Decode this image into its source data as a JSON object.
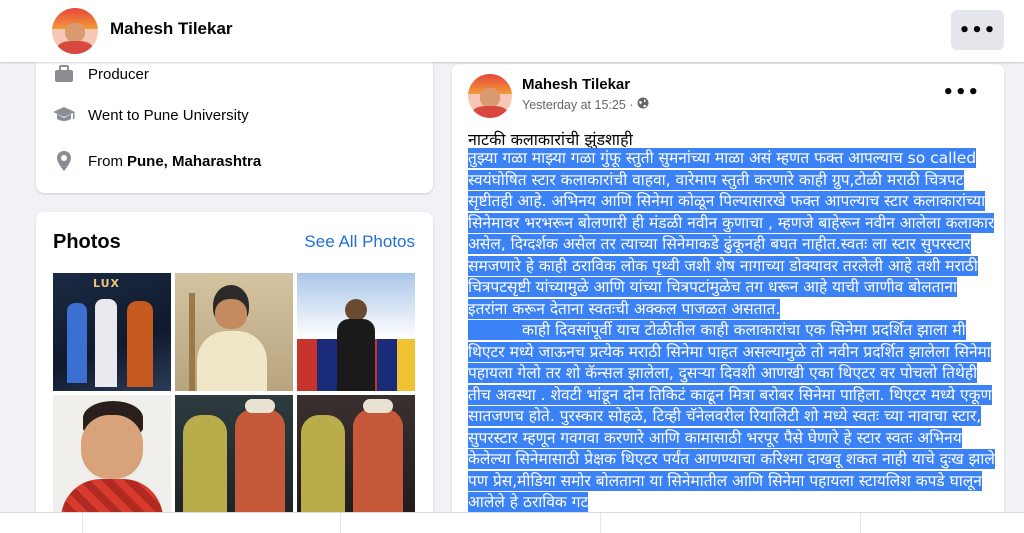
{
  "header": {
    "name": "Mahesh Tilekar",
    "more_label": "•••"
  },
  "intro": {
    "items": [
      {
        "icon": "briefcase-icon",
        "text": "Producer",
        "bold": ""
      },
      {
        "icon": "graduation-cap-icon",
        "text": "Went to Pune University",
        "bold": ""
      },
      {
        "icon": "location-pin-icon",
        "text": "From",
        "bold": "Pune, Maharashtra"
      }
    ]
  },
  "photos": {
    "title": "Photos",
    "see_all": "See All Photos",
    "tiles": [
      {
        "label": "LUX"
      },
      {
        "label": ""
      },
      {
        "label": ""
      },
      {
        "label": ""
      },
      {
        "label": ""
      },
      {
        "label": ""
      }
    ]
  },
  "post": {
    "author": "Mahesh Tilekar",
    "timestamp": "Yesterday at 15:25 ·",
    "privacy_icon": "globe-icon",
    "more_label": "•••",
    "title": "नाटकी कलाकारांची झुंडशाही",
    "paragraph1": "तुझ्या गळा माझ्या गळा गुंफू स्तुती सुमनांच्या माळा असं म्हणत फक्त आपल्याच so called स्वयंघोषित स्टार कलाकारांची वाहवा, वारेमाप स्तुती करणारे काही ग्रुप,टोळी मराठी चित्रपट सृष्टीतही आहे. अभिनय आणि सिनेमा कोळून पिल्यासारखे फक्त आपल्याच स्टार कलाकारांच्या सिनेमावर भरभरून बोलणारी ही मंडळी नवीन कुणाचा , म्हणजे बाहेरून नवीन आलेला कलाकार असेल, दिग्दर्शक असेल तर त्याच्या सिनेमाकडे ढुंकूनही बघत नाहीत.स्वतः ला स्टार सुपरस्टार समजणारे हे काही ठराविक लोक पृथ्वी जशी शेष नागाच्या डोक्यावर तरलेली आहे तशी मराठी चित्रपटसृष्टी यांच्यामुळे आणि यांच्या चित्रपटांमुळेच तग धरून आहे याची जाणीव  बोलताना इतरांना करून देताना स्वतःची अक्कल पाजळत असतात.",
    "paragraph2": "काही दिवसांपूर्वी याच टोळीतील काही कलाकारांचा एक  सिनेमा प्रदर्शित झाला मी थिएटर मध्ये  जाऊनच प्रत्येक मराठी सिनेमा पाहत असल्यामुळे तो नवीन प्रदर्शित झालेला सिनेमा पहायला गेलो तर शो कॅन्सल झालेला, दुसऱ्या दिवशी आणखी एका थिएटर वर पोचलो तिथेही तीच अवस्था . शेवटी भांडून दोन तिकिटं काढून मित्रा बरोबर सिनेमा पाहिला. थिएटर मध्ये एकूण सातजणच होते. पुरस्कार सोहळे, टिव्ही चॅनेलवरील रियालिटी शो मध्ये स्वतः च्या नावाचा स्टार, सुपरस्टार म्हणून गवगवा करणारे आणि कामासाठी भरपूर पैसे घेणारे हे स्टार स्वतः अभिनय केलेल्या सिनेमासाठी प्रेक्षक थिएटर पर्यंत आणण्याचा करिश्मा दाखवू शकत नाही याचे दुःख झाले पण प्रेस,मीडिया समोर बोलताना या सिनेमातील आणि सिनेमा पहायला स्टायलिश कपडे घालून आलेले हे ठराविक गट"
  },
  "colors": {
    "selection": "#3b82f6",
    "link": "#216fdb",
    "background": "#f0f2f5"
  }
}
